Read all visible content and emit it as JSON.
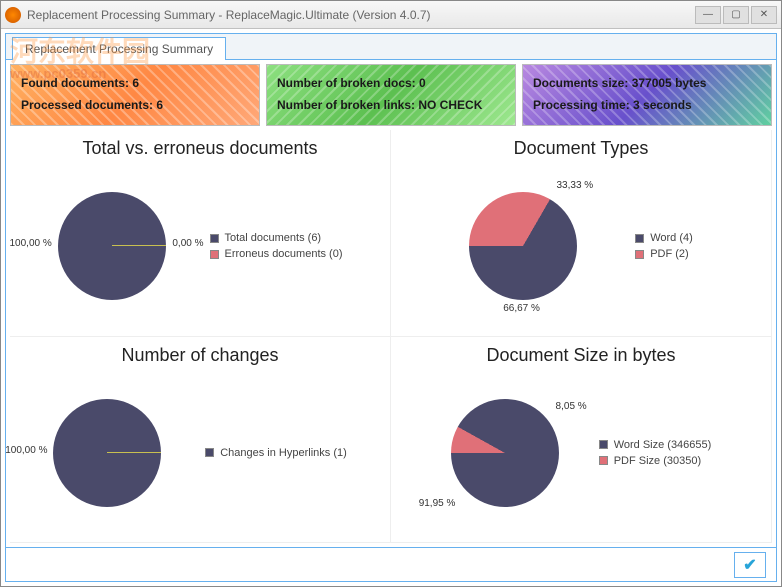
{
  "window": {
    "title": "Replacement Processing Summary - ReplaceMagic.Ultimate (Version 4.0.7)"
  },
  "tab": {
    "label": "Replacement Processing Summary"
  },
  "summary": {
    "box1": {
      "line1": "Found documents: 6",
      "line2": "Processed documents: 6"
    },
    "box2": {
      "line1": "Number of broken docs: 0",
      "line2": "Number of broken links: NO CHECK"
    },
    "box3": {
      "line1": "Documents size: 377005 bytes",
      "line2": "Processing time: 3 seconds"
    }
  },
  "charts": {
    "c1": {
      "title": "Total vs. erroneus documents",
      "left_pct": "100,00 %",
      "right_pct": "0,00 %",
      "legend1": "Total documents (6)",
      "legend2": "Erroneus documents (0)"
    },
    "c2": {
      "title": "Document Types",
      "top_pct": "33,33 %",
      "bot_pct": "66,67 %",
      "legend1": "Word (4)",
      "legend2": "PDF (2)"
    },
    "c3": {
      "title": "Number of changes",
      "left_pct": "100,00 %",
      "legend1": "Changes in Hyperlinks (1)"
    },
    "c4": {
      "title": "Document Size in bytes",
      "top_pct": "8,05 %",
      "bot_pct": "91,95 %",
      "legend1": "Word Size (346655)",
      "legend2": "PDF Size (30350)"
    }
  },
  "watermark": {
    "text": "河东软件园",
    "url": "www.pc0359.cn"
  },
  "chart_data": [
    {
      "type": "pie",
      "title": "Total vs. erroneus documents",
      "series": [
        {
          "name": "Total documents",
          "value": 6,
          "pct": 100.0,
          "color": "#4a4a6a"
        },
        {
          "name": "Erroneus documents",
          "value": 0,
          "pct": 0.0,
          "color": "#e07078"
        }
      ]
    },
    {
      "type": "pie",
      "title": "Document Types",
      "series": [
        {
          "name": "Word",
          "value": 4,
          "pct": 66.67,
          "color": "#4a4a6a"
        },
        {
          "name": "PDF",
          "value": 2,
          "pct": 33.33,
          "color": "#e07078"
        }
      ]
    },
    {
      "type": "pie",
      "title": "Number of changes",
      "series": [
        {
          "name": "Changes in Hyperlinks",
          "value": 1,
          "pct": 100.0,
          "color": "#4a4a6a"
        }
      ]
    },
    {
      "type": "pie",
      "title": "Document Size in bytes",
      "series": [
        {
          "name": "Word Size",
          "value": 346655,
          "pct": 91.95,
          "color": "#4a4a6a"
        },
        {
          "name": "PDF Size",
          "value": 30350,
          "pct": 8.05,
          "color": "#e07078"
        }
      ]
    }
  ]
}
